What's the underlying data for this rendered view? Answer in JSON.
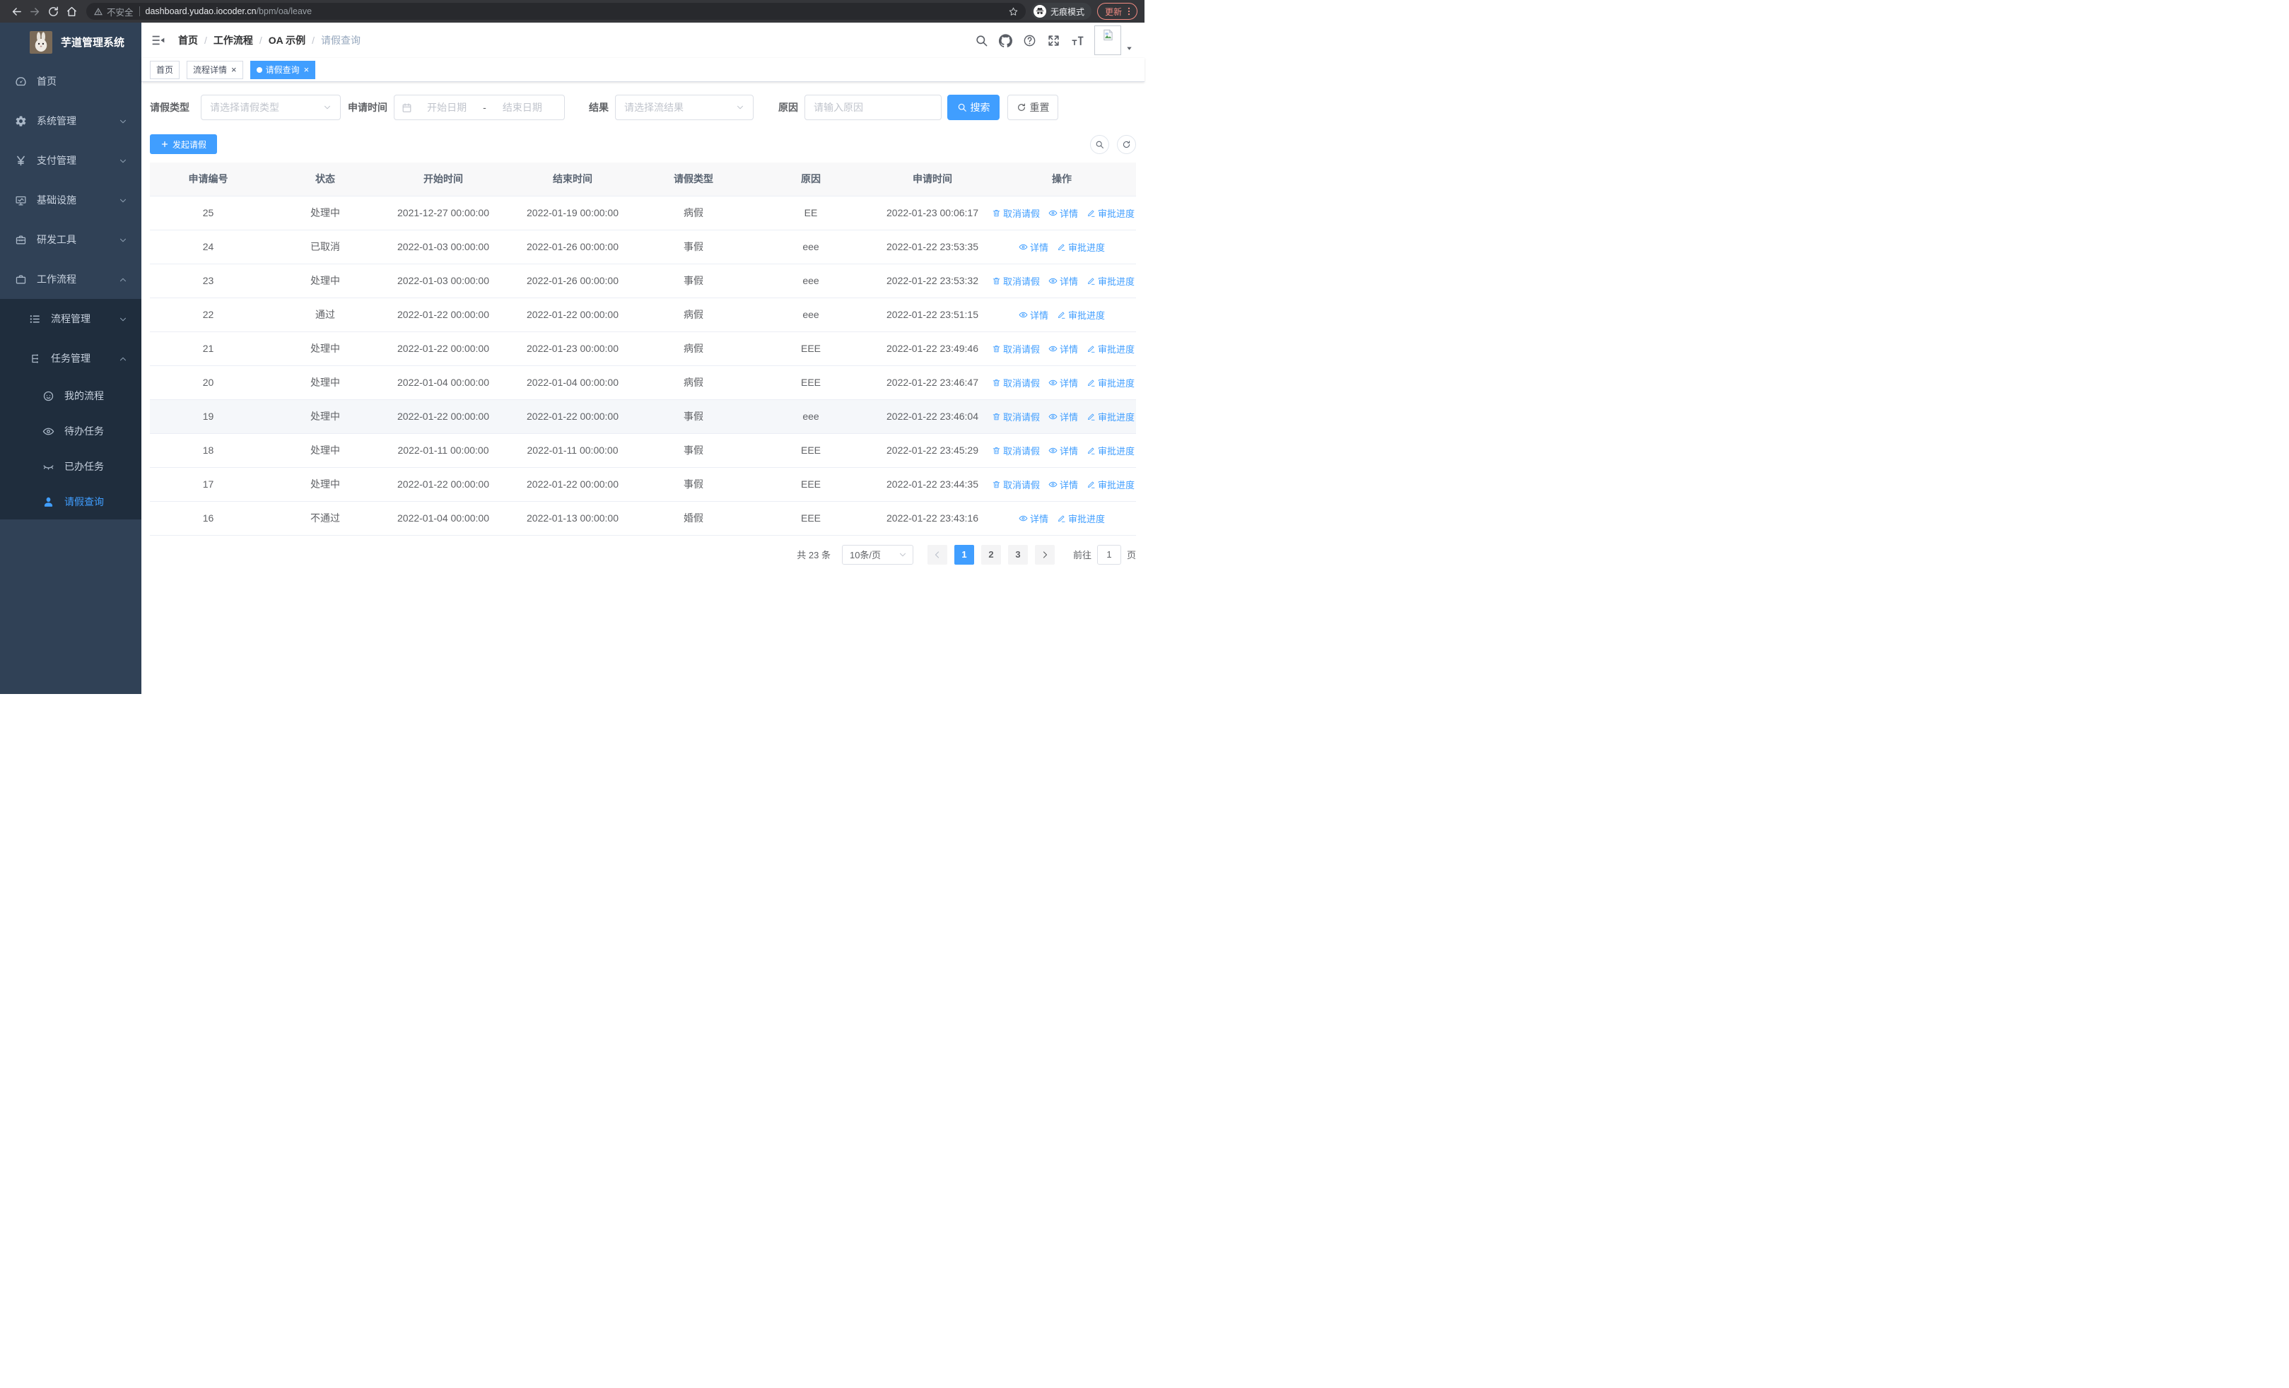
{
  "colors": {
    "primary": "#409EFF",
    "sidebar_bg": "#304156",
    "submenu_bg": "#1f2d3d"
  },
  "browser": {
    "security_label": "不安全",
    "url_host": "dashboard.yudao.iocoder.cn",
    "url_path": "/bpm/oa/leave",
    "incognito_label": "无痕模式",
    "update_label": "更新"
  },
  "sidebar": {
    "title": "芋道管理系统",
    "menu": [
      {
        "name": "home",
        "label": "首页",
        "icon": "dashboard-icon",
        "level": 1
      },
      {
        "name": "system-management",
        "label": "系统管理",
        "icon": "gear-icon",
        "level": 1,
        "arrow": "down"
      },
      {
        "name": "payment-management",
        "label": "支付管理",
        "icon": "yen-icon",
        "level": 1,
        "arrow": "down"
      },
      {
        "name": "infrastructure",
        "label": "基础设施",
        "icon": "monitor-icon",
        "level": 1,
        "arrow": "down"
      },
      {
        "name": "dev-tools",
        "label": "研发工具",
        "icon": "toolbox-icon",
        "level": 1,
        "arrow": "down"
      },
      {
        "name": "workflow",
        "label": "工作流程",
        "icon": "briefcase-icon",
        "level": 1,
        "arrow": "up"
      },
      {
        "name": "process-management",
        "label": "流程管理",
        "icon": "list-tree-icon",
        "level": 2,
        "arrow": "down",
        "dark": true
      },
      {
        "name": "task-management",
        "label": "任务管理",
        "icon": "flow-icon",
        "level": 2,
        "arrow": "up",
        "dark": true
      },
      {
        "name": "my-processes",
        "label": "我的流程",
        "icon": "face-icon",
        "level": 3,
        "dark": true
      },
      {
        "name": "todo-tasks",
        "label": "待办任务",
        "icon": "eye-icon",
        "level": 3,
        "dark": true
      },
      {
        "name": "done-tasks",
        "label": "已办任务",
        "icon": "eye-closed-icon",
        "level": 3,
        "dark": true
      },
      {
        "name": "leave-query",
        "label": "请假查询",
        "icon": "user-icon",
        "level": 3,
        "dark": true,
        "active": true
      }
    ]
  },
  "breadcrumb": {
    "separator": "/",
    "items": [
      "首页",
      "工作流程",
      "OA 示例",
      "请假查询"
    ]
  },
  "tabs": [
    {
      "name": "home",
      "label": "首页"
    },
    {
      "name": "process-detail",
      "label": "流程详情",
      "closable": true
    },
    {
      "name": "leave-query",
      "label": "请假查询",
      "closable": true,
      "active": true
    }
  ],
  "filters": {
    "leave_type": {
      "label": "请假类型",
      "placeholder": "请选择请假类型"
    },
    "apply_time": {
      "label": "申请时间",
      "start_placeholder": "开始日期",
      "separator": "-",
      "end_placeholder": "结束日期"
    },
    "result": {
      "label": "结果",
      "placeholder": "请选择流结果"
    },
    "reason": {
      "label": "原因",
      "placeholder": "请输入原因"
    },
    "search_label": "搜索",
    "reset_label": "重置"
  },
  "toolbar": {
    "create_label": "发起请假"
  },
  "table": {
    "columns": [
      "申请编号",
      "状态",
      "开始时间",
      "结束时间",
      "请假类型",
      "原因",
      "申请时间",
      "操作"
    ],
    "actions": {
      "cancel": "取消请假",
      "detail": "详情",
      "progress": "审批进度"
    },
    "rows": [
      {
        "id": "25",
        "status": "处理中",
        "start_time": "2021-12-27 00:00:00",
        "end_time": "2022-01-19 00:00:00",
        "leave_type": "病假",
        "reason": "EE",
        "apply_time": "2022-01-23 00:06:17",
        "can_cancel": true
      },
      {
        "id": "24",
        "status": "已取消",
        "start_time": "2022-01-03 00:00:00",
        "end_time": "2022-01-26 00:00:00",
        "leave_type": "事假",
        "reason": "eee",
        "apply_time": "2022-01-22 23:53:35",
        "can_cancel": false
      },
      {
        "id": "23",
        "status": "处理中",
        "start_time": "2022-01-03 00:00:00",
        "end_time": "2022-01-26 00:00:00",
        "leave_type": "事假",
        "reason": "eee",
        "apply_time": "2022-01-22 23:53:32",
        "can_cancel": true
      },
      {
        "id": "22",
        "status": "通过",
        "start_time": "2022-01-22 00:00:00",
        "end_time": "2022-01-22 00:00:00",
        "leave_type": "病假",
        "reason": "eee",
        "apply_time": "2022-01-22 23:51:15",
        "can_cancel": false
      },
      {
        "id": "21",
        "status": "处理中",
        "start_time": "2022-01-22 00:00:00",
        "end_time": "2022-01-23 00:00:00",
        "leave_type": "病假",
        "reason": "EEE",
        "apply_time": "2022-01-22 23:49:46",
        "can_cancel": true
      },
      {
        "id": "20",
        "status": "处理中",
        "start_time": "2022-01-04 00:00:00",
        "end_time": "2022-01-04 00:00:00",
        "leave_type": "病假",
        "reason": "EEE",
        "apply_time": "2022-01-22 23:46:47",
        "can_cancel": true
      },
      {
        "id": "19",
        "status": "处理中",
        "start_time": "2022-01-22 00:00:00",
        "end_time": "2022-01-22 00:00:00",
        "leave_type": "事假",
        "reason": "eee",
        "apply_time": "2022-01-22 23:46:04",
        "can_cancel": true,
        "highlight": true
      },
      {
        "id": "18",
        "status": "处理中",
        "start_time": "2022-01-11 00:00:00",
        "end_time": "2022-01-11 00:00:00",
        "leave_type": "事假",
        "reason": "EEE",
        "apply_time": "2022-01-22 23:45:29",
        "can_cancel": true
      },
      {
        "id": "17",
        "status": "处理中",
        "start_time": "2022-01-22 00:00:00",
        "end_time": "2022-01-22 00:00:00",
        "leave_type": "事假",
        "reason": "EEE",
        "apply_time": "2022-01-22 23:44:35",
        "can_cancel": true
      },
      {
        "id": "16",
        "status": "不通过",
        "start_time": "2022-01-04 00:00:00",
        "end_time": "2022-01-13 00:00:00",
        "leave_type": "婚假",
        "reason": "EEE",
        "apply_time": "2022-01-22 23:43:16",
        "can_cancel": false
      }
    ]
  },
  "pagination": {
    "total_label": "共 23 条",
    "page_size_label": "10条/页",
    "pages": [
      "1",
      "2",
      "3"
    ],
    "active_page": "1",
    "goto_label": "前往",
    "goto_value": "1",
    "goto_suffix": "页"
  }
}
